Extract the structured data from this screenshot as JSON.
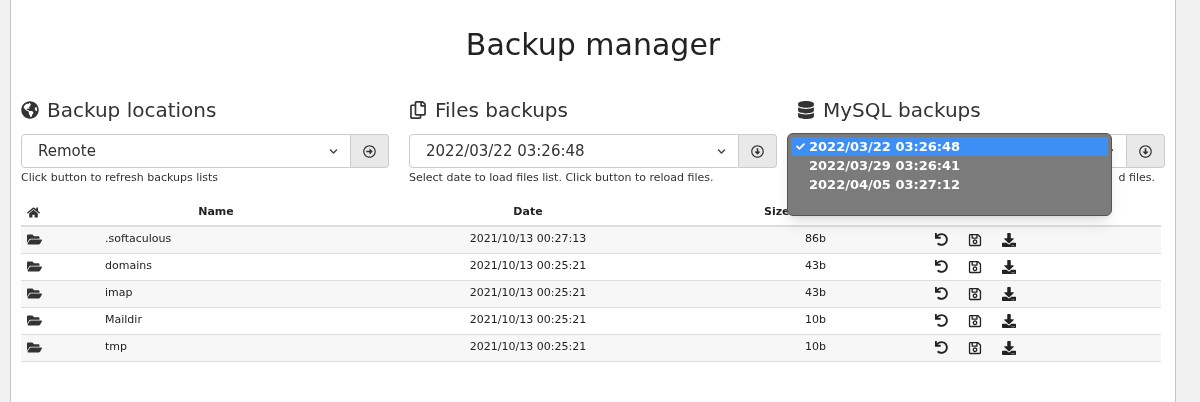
{
  "title": "Backup manager",
  "sections": [
    {
      "kind": "locations",
      "heading": "Backup locations",
      "select_value": "Remote",
      "helper": "Click button to refresh backups lists"
    },
    {
      "kind": "files",
      "heading": "Files backups",
      "select_value": "2022/03/22 03:26:48",
      "helper": "Select date to load files list. Click button to reload files."
    },
    {
      "kind": "mysql",
      "heading": "MySQL backups",
      "helper": "d files.",
      "open_options": [
        {
          "label": "2022/03/22 03:26:48",
          "selected": true
        },
        {
          "label": "2022/03/29 03:26:41",
          "selected": false
        },
        {
          "label": "2022/04/05 03:27:12",
          "selected": false
        }
      ]
    }
  ],
  "table": {
    "columns": [
      "Name",
      "Date",
      "Size"
    ],
    "rows": [
      {
        "name": ".softaculous",
        "date": "2021/10/13 00:27:13",
        "size": "86b"
      },
      {
        "name": "domains",
        "date": "2021/10/13 00:25:21",
        "size": "43b"
      },
      {
        "name": "imap",
        "date": "2021/10/13 00:25:21",
        "size": "43b"
      },
      {
        "name": "Maildir",
        "date": "2021/10/13 00:25:21",
        "size": "10b"
      },
      {
        "name": "tmp",
        "date": "2021/10/13 00:25:21",
        "size": "10b"
      }
    ]
  }
}
